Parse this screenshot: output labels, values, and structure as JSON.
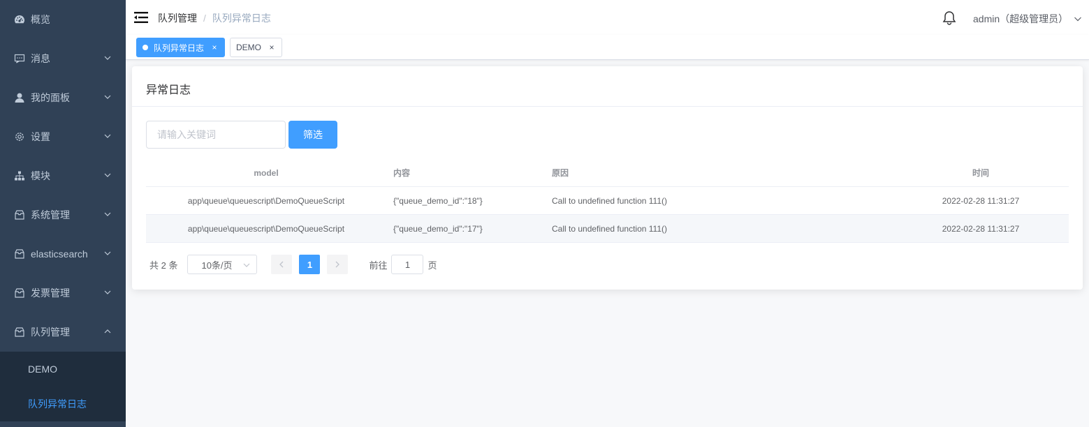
{
  "sidebar": {
    "items": [
      {
        "label": "概览",
        "icon": "dashboard-icon"
      },
      {
        "label": "消息",
        "icon": "message-icon"
      },
      {
        "label": "我的面板",
        "icon": "user-icon"
      },
      {
        "label": "设置",
        "icon": "gear-icon"
      },
      {
        "label": "模块",
        "icon": "tree-icon"
      },
      {
        "label": "系统管理",
        "icon": "box-icon"
      },
      {
        "label": "elasticsearch",
        "icon": "box-icon"
      },
      {
        "label": "发票管理",
        "icon": "box-icon"
      },
      {
        "label": "队列管理",
        "icon": "box-icon"
      }
    ],
    "submenu": [
      {
        "label": "DEMO"
      },
      {
        "label": "队列异常日志"
      }
    ],
    "active_color": "#409eff",
    "bg_color": "#304156"
  },
  "navbar": {
    "breadcrumb": [
      "队列管理",
      "队列异常日志"
    ],
    "separator": "/",
    "user": "admin（超级管理员）"
  },
  "tags": [
    {
      "label": "队列异常日志",
      "active": true
    },
    {
      "label": "DEMO",
      "active": false
    }
  ],
  "tag_close": "×",
  "card": {
    "title": "异常日志"
  },
  "search": {
    "placeholder": "请输入关键词",
    "value": "",
    "button": "筛选"
  },
  "table": {
    "columns": [
      "model",
      "内容",
      "原因",
      "时间"
    ],
    "rows": [
      [
        "app\\queue\\queuescript\\DemoQueueScript",
        "{\"queue_demo_id\":\"18\"}",
        "Call to undefined function 111()",
        "2022-02-28 11:31:27"
      ],
      [
        "app\\queue\\queuescript\\DemoQueueScript",
        "{\"queue_demo_id\":\"17\"}",
        "Call to undefined function 111()",
        "2022-02-28 11:31:27"
      ]
    ]
  },
  "pagination": {
    "total": "共 2 条",
    "page_size": "10条/页",
    "current_page": "1",
    "goto_prefix": "前往",
    "goto_value": "1",
    "goto_suffix": "页"
  }
}
